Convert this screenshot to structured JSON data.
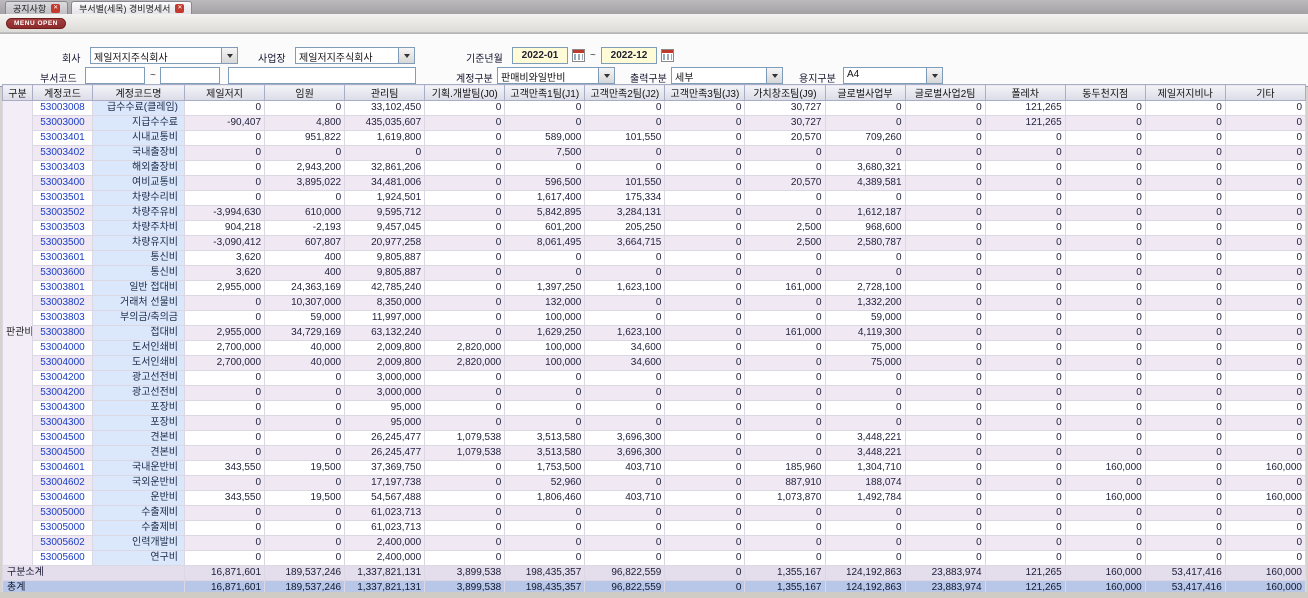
{
  "tabs": [
    {
      "label": "공지사항"
    },
    {
      "label": "부서별(세목) 경비명세서"
    }
  ],
  "menu_button": "MENU OPEN",
  "filters": {
    "company_label": "회사",
    "company_value": "제일저지주식회사",
    "site_label": "사업장",
    "site_value": "제일저지주식회사",
    "period_label": "기준년월",
    "period_from": "2022-01",
    "period_to": "2022-12",
    "tilde": "~",
    "dept_label": "부서코드",
    "dept_from": "",
    "dept_to": "",
    "dept_name": "",
    "account_label": "계정구분",
    "account_value": "판매비와일반비",
    "output_label": "출력구분",
    "output_value": "세부",
    "paper_label": "용지구분",
    "paper_value": "A4"
  },
  "table": {
    "columns": [
      "구분",
      "계정코드",
      "계정코드명",
      "제일저지",
      "임원",
      "관리팀",
      "기획.개발팀(J0)",
      "고객만족1팀(J1)",
      "고객만족2팀(J2)",
      "고객만족3팀(J3)",
      "가치창조팀(J9)",
      "글로벌사업부",
      "글로벌사업2팀",
      "폴레차",
      "동두천지점",
      "제일저지비나",
      "기타"
    ],
    "group_label": "판관비",
    "rows": [
      {
        "code": "53003008",
        "name": "급수수료(클레임)",
        "values": [
          "0",
          "0",
          "33,102,450",
          "0",
          "0",
          "0",
          "0",
          "30,727",
          "0",
          "0",
          "121,265",
          "0",
          "0",
          "0"
        ]
      },
      {
        "code": "53003000",
        "name": "지급수수료",
        "values": [
          "-90,407",
          "4,800",
          "435,035,607",
          "0",
          "0",
          "0",
          "0",
          "30,727",
          "0",
          "0",
          "121,265",
          "0",
          "0",
          "0"
        ]
      },
      {
        "code": "53003401",
        "name": "시내교통비",
        "values": [
          "0",
          "951,822",
          "1,619,800",
          "0",
          "589,000",
          "101,550",
          "0",
          "20,570",
          "709,260",
          "0",
          "0",
          "0",
          "0",
          "0"
        ]
      },
      {
        "code": "53003402",
        "name": "국내출장비",
        "values": [
          "0",
          "0",
          "0",
          "0",
          "7,500",
          "0",
          "0",
          "0",
          "0",
          "0",
          "0",
          "0",
          "0",
          "0"
        ]
      },
      {
        "code": "53003403",
        "name": "해외출장비",
        "values": [
          "0",
          "2,943,200",
          "32,861,206",
          "0",
          "0",
          "0",
          "0",
          "0",
          "3,680,321",
          "0",
          "0",
          "0",
          "0",
          "0"
        ]
      },
      {
        "code": "53003400",
        "name": "여비교통비",
        "values": [
          "0",
          "3,895,022",
          "34,481,006",
          "0",
          "596,500",
          "101,550",
          "0",
          "20,570",
          "4,389,581",
          "0",
          "0",
          "0",
          "0",
          "0"
        ]
      },
      {
        "code": "53003501",
        "name": "차량수리비",
        "values": [
          "0",
          "0",
          "1,924,501",
          "0",
          "1,617,400",
          "175,334",
          "0",
          "0",
          "0",
          "0",
          "0",
          "0",
          "0",
          "0"
        ]
      },
      {
        "code": "53003502",
        "name": "차량주유비",
        "values": [
          "-3,994,630",
          "610,000",
          "9,595,712",
          "0",
          "5,842,895",
          "3,284,131",
          "0",
          "0",
          "1,612,187",
          "0",
          "0",
          "0",
          "0",
          "0"
        ]
      },
      {
        "code": "53003503",
        "name": "차량주차비",
        "values": [
          "904,218",
          "-2,193",
          "9,457,045",
          "0",
          "601,200",
          "205,250",
          "0",
          "2,500",
          "968,600",
          "0",
          "0",
          "0",
          "0",
          "0"
        ]
      },
      {
        "code": "53003500",
        "name": "차량유지비",
        "values": [
          "-3,090,412",
          "607,807",
          "20,977,258",
          "0",
          "8,061,495",
          "3,664,715",
          "0",
          "2,500",
          "2,580,787",
          "0",
          "0",
          "0",
          "0",
          "0"
        ]
      },
      {
        "code": "53003601",
        "name": "통신비",
        "values": [
          "3,620",
          "400",
          "9,805,887",
          "0",
          "0",
          "0",
          "0",
          "0",
          "0",
          "0",
          "0",
          "0",
          "0",
          "0"
        ]
      },
      {
        "code": "53003600",
        "name": "통신비",
        "values": [
          "3,620",
          "400",
          "9,805,887",
          "0",
          "0",
          "0",
          "0",
          "0",
          "0",
          "0",
          "0",
          "0",
          "0",
          "0"
        ]
      },
      {
        "code": "53003801",
        "name": "일반 접대비",
        "values": [
          "2,955,000",
          "24,363,169",
          "42,785,240",
          "0",
          "1,397,250",
          "1,623,100",
          "0",
          "161,000",
          "2,728,100",
          "0",
          "0",
          "0",
          "0",
          "0"
        ]
      },
      {
        "code": "53003802",
        "name": "거래처 선물비",
        "values": [
          "0",
          "10,307,000",
          "8,350,000",
          "0",
          "132,000",
          "0",
          "0",
          "0",
          "1,332,200",
          "0",
          "0",
          "0",
          "0",
          "0"
        ]
      },
      {
        "code": "53003803",
        "name": "부의금/축의금",
        "values": [
          "0",
          "59,000",
          "11,997,000",
          "0",
          "100,000",
          "0",
          "0",
          "0",
          "59,000",
          "0",
          "0",
          "0",
          "0",
          "0"
        ]
      },
      {
        "code": "53003800",
        "name": "접대비",
        "values": [
          "2,955,000",
          "34,729,169",
          "63,132,240",
          "0",
          "1,629,250",
          "1,623,100",
          "0",
          "161,000",
          "4,119,300",
          "0",
          "0",
          "0",
          "0",
          "0"
        ]
      },
      {
        "code": "53004000",
        "name": "도서인쇄비",
        "values": [
          "2,700,000",
          "40,000",
          "2,009,800",
          "2,820,000",
          "100,000",
          "34,600",
          "0",
          "0",
          "75,000",
          "0",
          "0",
          "0",
          "0",
          "0"
        ]
      },
      {
        "code": "53004000",
        "name": "도서인쇄비",
        "values": [
          "2,700,000",
          "40,000",
          "2,009,800",
          "2,820,000",
          "100,000",
          "34,600",
          "0",
          "0",
          "75,000",
          "0",
          "0",
          "0",
          "0",
          "0"
        ]
      },
      {
        "code": "53004200",
        "name": "광고선전비",
        "values": [
          "0",
          "0",
          "3,000,000",
          "0",
          "0",
          "0",
          "0",
          "0",
          "0",
          "0",
          "0",
          "0",
          "0",
          "0"
        ]
      },
      {
        "code": "53004200",
        "name": "광고선전비",
        "values": [
          "0",
          "0",
          "3,000,000",
          "0",
          "0",
          "0",
          "0",
          "0",
          "0",
          "0",
          "0",
          "0",
          "0",
          "0"
        ]
      },
      {
        "code": "53004300",
        "name": "포장비",
        "values": [
          "0",
          "0",
          "95,000",
          "0",
          "0",
          "0",
          "0",
          "0",
          "0",
          "0",
          "0",
          "0",
          "0",
          "0"
        ]
      },
      {
        "code": "53004300",
        "name": "포장비",
        "values": [
          "0",
          "0",
          "95,000",
          "0",
          "0",
          "0",
          "0",
          "0",
          "0",
          "0",
          "0",
          "0",
          "0",
          "0"
        ]
      },
      {
        "code": "53004500",
        "name": "견본비",
        "values": [
          "0",
          "0",
          "26,245,477",
          "1,079,538",
          "3,513,580",
          "3,696,300",
          "0",
          "0",
          "3,448,221",
          "0",
          "0",
          "0",
          "0",
          "0"
        ]
      },
      {
        "code": "53004500",
        "name": "견본비",
        "values": [
          "0",
          "0",
          "26,245,477",
          "1,079,538",
          "3,513,580",
          "3,696,300",
          "0",
          "0",
          "3,448,221",
          "0",
          "0",
          "0",
          "0",
          "0"
        ]
      },
      {
        "code": "53004601",
        "name": "국내운반비",
        "values": [
          "343,550",
          "19,500",
          "37,369,750",
          "0",
          "1,753,500",
          "403,710",
          "0",
          "185,960",
          "1,304,710",
          "0",
          "0",
          "160,000",
          "0",
          "160,000"
        ]
      },
      {
        "code": "53004602",
        "name": "국외운반비",
        "values": [
          "0",
          "0",
          "17,197,738",
          "0",
          "52,960",
          "0",
          "0",
          "887,910",
          "188,074",
          "0",
          "0",
          "0",
          "0",
          "0"
        ]
      },
      {
        "code": "53004600",
        "name": "운반비",
        "values": [
          "343,550",
          "19,500",
          "54,567,488",
          "0",
          "1,806,460",
          "403,710",
          "0",
          "1,073,870",
          "1,492,784",
          "0",
          "0",
          "160,000",
          "0",
          "160,000"
        ]
      },
      {
        "code": "53005000",
        "name": "수출제비",
        "values": [
          "0",
          "0",
          "61,023,713",
          "0",
          "0",
          "0",
          "0",
          "0",
          "0",
          "0",
          "0",
          "0",
          "0",
          "0"
        ]
      },
      {
        "code": "53005000",
        "name": "수출제비",
        "values": [
          "0",
          "0",
          "61,023,713",
          "0",
          "0",
          "0",
          "0",
          "0",
          "0",
          "0",
          "0",
          "0",
          "0",
          "0"
        ]
      },
      {
        "code": "53005602",
        "name": "인력개발비",
        "values": [
          "0",
          "0",
          "2,400,000",
          "0",
          "0",
          "0",
          "0",
          "0",
          "0",
          "0",
          "0",
          "0",
          "0",
          "0"
        ]
      },
      {
        "code": "53005600",
        "name": "연구비",
        "values": [
          "0",
          "0",
          "2,400,000",
          "0",
          "0",
          "0",
          "0",
          "0",
          "0",
          "0",
          "0",
          "0",
          "0",
          "0"
        ]
      }
    ],
    "subtotal": {
      "label": "구분소계",
      "values": [
        "16,871,601",
        "189,537,246",
        "1,337,821,131",
        "3,899,538",
        "198,435,357",
        "96,822,559",
        "0",
        "1,355,167",
        "124,192,863",
        "23,883,974",
        "121,265",
        "160,000",
        "53,417,416",
        "160,000"
      ]
    },
    "total": {
      "label": "총계",
      "values": [
        "16,871,601",
        "189,537,246",
        "1,337,821,131",
        "3,899,538",
        "198,435,357",
        "96,822,559",
        "0",
        "1,355,167",
        "124,192,863",
        "23,883,974",
        "121,265",
        "160,000",
        "53,417,416",
        "160,000"
      ]
    }
  }
}
